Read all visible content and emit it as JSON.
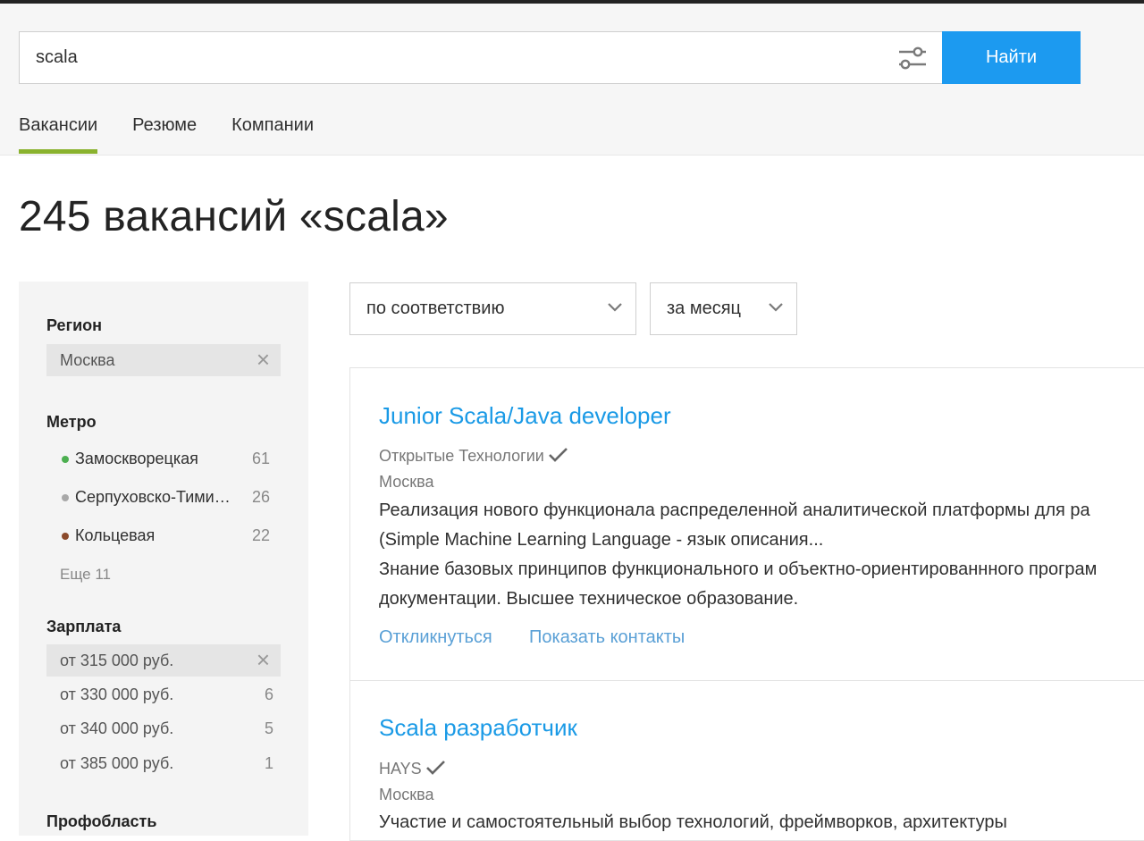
{
  "search": {
    "value": "scala",
    "button_label": "Найти"
  },
  "tabs": [
    {
      "label": "Вакансии",
      "active": true
    },
    {
      "label": "Резюме",
      "active": false
    },
    {
      "label": "Компании",
      "active": false
    }
  ],
  "page_title": "245 вакансий «scala»",
  "sidebar": {
    "region": {
      "title": "Регион",
      "selected": "Москва"
    },
    "metro": {
      "title": "Метро",
      "items": [
        {
          "name": "Замоскворецкая",
          "count": "61",
          "color": "#4caf50"
        },
        {
          "name": "Серпуховско-Тимирязевская",
          "count": "26",
          "color": "#a8a8a8"
        },
        {
          "name": "Кольцевая",
          "count": "22",
          "color": "#8b4a2b"
        }
      ],
      "more": "Еще 11"
    },
    "salary": {
      "title": "Зарплата",
      "selected": "от 315 000 руб.",
      "items": [
        {
          "label": "от 330 000 руб.",
          "count": "6"
        },
        {
          "label": "от 340 000 руб.",
          "count": "5"
        },
        {
          "label": "от 385 000 руб.",
          "count": "1"
        }
      ]
    },
    "next_section_title": "Профобласть"
  },
  "sort": {
    "order": "по соответствию",
    "period": "за месяц"
  },
  "vacancies": [
    {
      "title": "Junior Scala/Java developer",
      "company": "Открытые Технологии",
      "city": "Москва",
      "snippet_lines": [
        "Реализация нового функционала распределенной аналитической платформы для ра",
        "(Simple Machine Learning Language - язык описания...",
        "Знание базовых принципов функционального и объектно-ориентированнного програм",
        "документации. Высшее техническое образование."
      ],
      "respond_label": "Откликнуться",
      "contacts_label": "Показать контакты"
    },
    {
      "title": "Scala разработчик",
      "company": "HAYS",
      "city": "Москва",
      "snippet_lines": [
        "Участие и самостоятельный выбор технологий, фреймворков, архитектуры"
      ]
    }
  ],
  "colors": {
    "accent_blue": "#1c9af0",
    "link_blue": "#1a9ae6",
    "tab_underline": "#8ab22e"
  }
}
